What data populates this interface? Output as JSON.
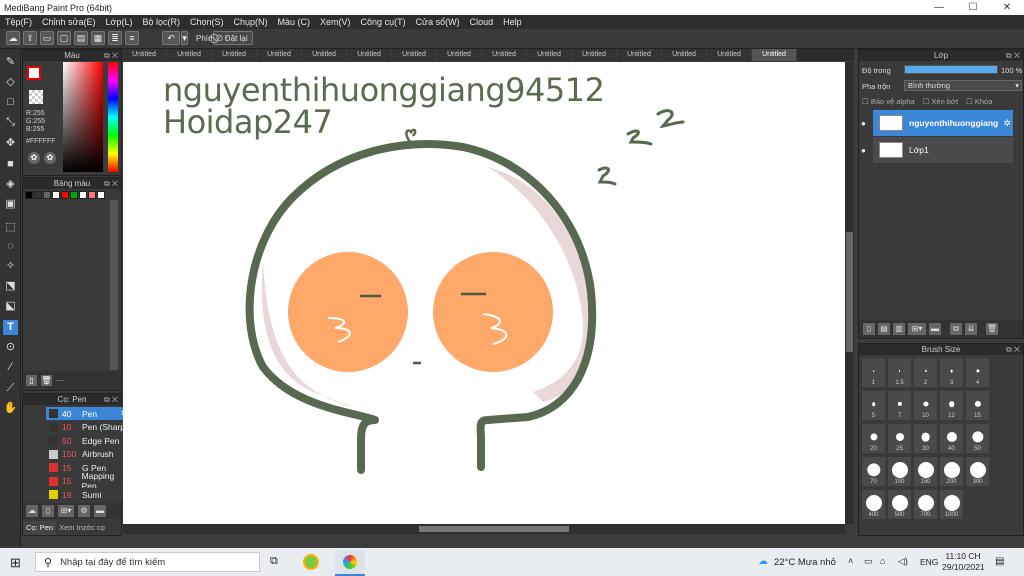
{
  "window": {
    "title": "MediBang Paint Pro (64bit)",
    "minimize": "—",
    "maximize": "☐",
    "close": "✕"
  },
  "menu": [
    "Tệp(F)",
    "Chỉnh sửa(E)",
    "Lớp(L)",
    "Bộ lọc(R)",
    "Chọn(S)",
    "Chụp(N)",
    "Màu (C)",
    "Xem(V)",
    "Công cụ(T)",
    "Cửa sổ(W)",
    "Cloud",
    "Help"
  ],
  "toolbar": {
    "shortcut_label": "Phím",
    "reset_label": "Đặt lại"
  },
  "color_panel": {
    "title": "Màu",
    "r": "R:255",
    "g": "G:255",
    "b": "B:255",
    "hex": "#FFFFFF"
  },
  "palette_panel": {
    "title": "Bảng màu",
    "more": "···",
    "swatches": [
      "#000000",
      "#333333",
      "#666666",
      "#ffffff",
      "#ff0000",
      "#00aa00",
      "#ffffff",
      "#ff7777",
      "#ffffff"
    ]
  },
  "brush_panel": {
    "title": "Cọ: Pen",
    "items": [
      {
        "size": "40",
        "name": "Pen",
        "color": "#333333",
        "selected": true
      },
      {
        "size": "10",
        "name": "Pen (Sharp)",
        "color": "#333333"
      },
      {
        "size": "50",
        "name": "Edge Pen",
        "color": "#333333"
      },
      {
        "size": "150",
        "name": "Airbrush",
        "color": "#cccccc"
      },
      {
        "size": "15",
        "name": "G Pen",
        "color": "#e03030"
      },
      {
        "size": "15",
        "name": "Mapping Pen",
        "color": "#e03030"
      },
      {
        "size": "19",
        "name": "Sumi",
        "color": "#e0d000"
      }
    ],
    "tab1": "Cọ: Pen",
    "tab2": "Xem trước cọ"
  },
  "doc_tabs": [
    "Untitled",
    "Untitled",
    "Untitled",
    "Untitled",
    "Untitled",
    "Untitled",
    "Untitled",
    "Untitled",
    "Untitled",
    "Untitled",
    "Untitled",
    "Untitled",
    "Untitled",
    "Untitled",
    "Untitled"
  ],
  "canvas": {
    "line1": "nguyenthihuonggiang94512",
    "line2": "Hoidap247",
    "zzz": "z"
  },
  "layer_panel": {
    "title": "Lớp",
    "opacity_label": "Độ trong",
    "opacity_value": "100 %",
    "opacity": 1.0,
    "blend_label": "Pha trộn",
    "blend_value": "Bình thường",
    "protect_alpha": "Bảo vệ alpha",
    "clipping": "Xén bớt",
    "lock": "Khóa",
    "layers": [
      {
        "name": "nguyenthihuonggiang",
        "selected": true
      },
      {
        "name": "Lớp1",
        "selected": false
      }
    ]
  },
  "brush_size_panel": {
    "title": "Brush Size",
    "sizes": [
      "1",
      "1.5",
      "2",
      "3",
      "4",
      "5",
      "7",
      "10",
      "12",
      "15",
      "20",
      "25",
      "30",
      "40",
      "50",
      "70",
      "100",
      "150",
      "200",
      "300",
      "400",
      "500",
      "700",
      "1000"
    ]
  },
  "taskbar": {
    "search_placeholder": "Nhập tại đây để tìm kiếm",
    "weather": "22°C  Mưa nhỏ",
    "lang": "ENG",
    "time": "11:10 CH",
    "date": "29/10/2021"
  },
  "colors": {
    "face_outline": "#58694f",
    "cheek": "#fea869",
    "shade": "#ead7d7",
    "text": "#5a6b52",
    "accent": "#3b86d6"
  }
}
